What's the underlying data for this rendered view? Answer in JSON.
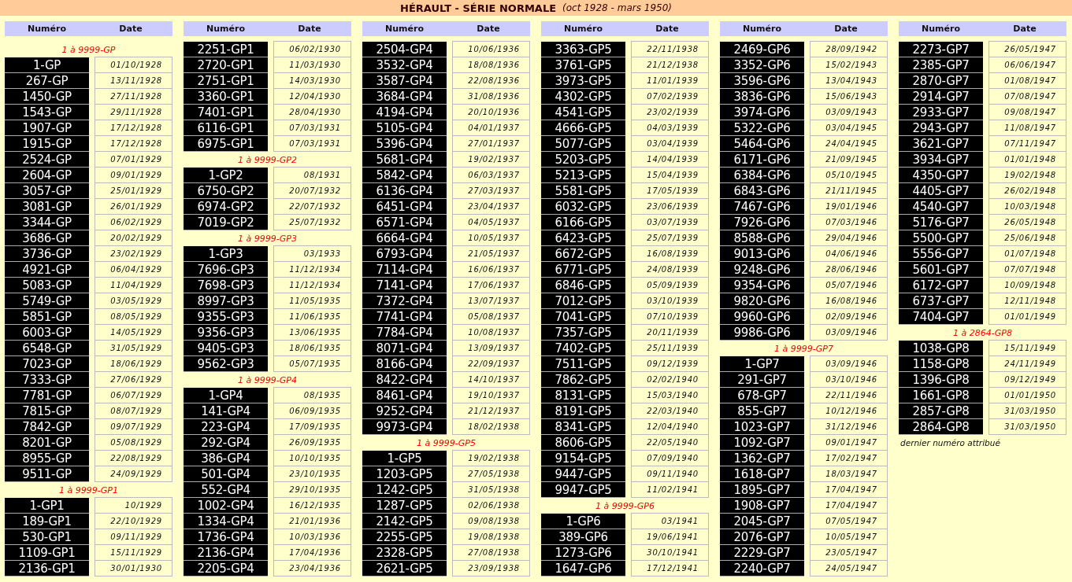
{
  "title": "HÉRAULT - SÉRIE NORMALE",
  "subtitle": "(oct 1928 - mars 1950)",
  "columns": [
    {
      "header": {
        "number": "Numéro",
        "date": "Date"
      },
      "items": [
        {
          "kind": "series",
          "label": "1 à 9999-GP"
        },
        {
          "kind": "plate",
          "number": "1-GP",
          "date": "01/10/1928"
        },
        {
          "kind": "plate",
          "number": "267-GP",
          "date": "13/11/1928"
        },
        {
          "kind": "plate",
          "number": "1450-GP",
          "date": "27/11/1928"
        },
        {
          "kind": "plate",
          "number": "1543-GP",
          "date": "29/11/1928"
        },
        {
          "kind": "plate",
          "number": "1907-GP",
          "date": "17/12/1928"
        },
        {
          "kind": "plate",
          "number": "1915-GP",
          "date": "17/12/1928"
        },
        {
          "kind": "plate",
          "number": "2524-GP",
          "date": "07/01/1929"
        },
        {
          "kind": "plate",
          "number": "2604-GP",
          "date": "09/01/1929"
        },
        {
          "kind": "plate",
          "number": "3057-GP",
          "date": "25/01/1929"
        },
        {
          "kind": "plate",
          "number": "3081-GP",
          "date": "26/01/1929"
        },
        {
          "kind": "plate",
          "number": "3344-GP",
          "date": "06/02/1929"
        },
        {
          "kind": "plate",
          "number": "3686-GP",
          "date": "20/02/1929"
        },
        {
          "kind": "plate",
          "number": "3736-GP",
          "date": "23/02/1929"
        },
        {
          "kind": "plate",
          "number": "4921-GP",
          "date": "06/04/1929"
        },
        {
          "kind": "plate",
          "number": "5083-GP",
          "date": "11/04/1929"
        },
        {
          "kind": "plate",
          "number": "5749-GP",
          "date": "03/05/1929"
        },
        {
          "kind": "plate",
          "number": "5851-GP",
          "date": "08/05/1929"
        },
        {
          "kind": "plate",
          "number": "6003-GP",
          "date": "14/05/1929"
        },
        {
          "kind": "plate",
          "number": "6548-GP",
          "date": "31/05/1929"
        },
        {
          "kind": "plate",
          "number": "7023-GP",
          "date": "18/06/1929"
        },
        {
          "kind": "plate",
          "number": "7333-GP",
          "date": "27/06/1929"
        },
        {
          "kind": "plate",
          "number": "7781-GP",
          "date": "06/07/1929"
        },
        {
          "kind": "plate",
          "number": "7815-GP",
          "date": "08/07/1929"
        },
        {
          "kind": "plate",
          "number": "7842-GP",
          "date": "09/07/1929"
        },
        {
          "kind": "plate",
          "number": "8201-GP",
          "date": "05/08/1929"
        },
        {
          "kind": "plate",
          "number": "8955-GP",
          "date": "22/08/1929"
        },
        {
          "kind": "plate",
          "number": "9511-GP",
          "date": "24/09/1929"
        },
        {
          "kind": "series",
          "label": "1 à 9999-GP1"
        },
        {
          "kind": "plate",
          "number": "1-GP1",
          "date": "10/1929"
        },
        {
          "kind": "plate",
          "number": "189-GP1",
          "date": "22/10/1929"
        },
        {
          "kind": "plate",
          "number": "530-GP1",
          "date": "09/11/1929"
        },
        {
          "kind": "plate",
          "number": "1109-GP1",
          "date": "15/11/1929"
        },
        {
          "kind": "plate",
          "number": "2136-GP1",
          "date": "30/01/1930"
        }
      ]
    },
    {
      "header": {
        "number": "Numéro",
        "date": "Date"
      },
      "items": [
        {
          "kind": "plate",
          "number": "2251-GP1",
          "date": "06/02/1930"
        },
        {
          "kind": "plate",
          "number": "2720-GP1",
          "date": "11/03/1930"
        },
        {
          "kind": "plate",
          "number": "2751-GP1",
          "date": "14/03/1930"
        },
        {
          "kind": "plate",
          "number": "3360-GP1",
          "date": "12/04/1930"
        },
        {
          "kind": "plate",
          "number": "7401-GP1",
          "date": "28/04/1930"
        },
        {
          "kind": "plate",
          "number": "6116-GP1",
          "date": "07/03/1931"
        },
        {
          "kind": "plate",
          "number": "6975-GP1",
          "date": "07/03/1931"
        },
        {
          "kind": "series",
          "label": "1 à 9999-GP2"
        },
        {
          "kind": "plate",
          "number": "1-GP2",
          "date": "08/1931"
        },
        {
          "kind": "plate",
          "number": "6750-GP2",
          "date": "20/07/1932"
        },
        {
          "kind": "plate",
          "number": "6974-GP2",
          "date": "22/07/1932"
        },
        {
          "kind": "plate",
          "number": "7019-GP2",
          "date": "25/07/1932"
        },
        {
          "kind": "series",
          "label": "1 à 9999-GP3"
        },
        {
          "kind": "plate",
          "number": "1-GP3",
          "date": "03/1933"
        },
        {
          "kind": "plate",
          "number": "7696-GP3",
          "date": "11/12/1934"
        },
        {
          "kind": "plate",
          "number": "7698-GP3",
          "date": "11/12/1934"
        },
        {
          "kind": "plate",
          "number": "8997-GP3",
          "date": "11/05/1935"
        },
        {
          "kind": "plate",
          "number": "9355-GP3",
          "date": "11/06/1935"
        },
        {
          "kind": "plate",
          "number": "9356-GP3",
          "date": "13/06/1935"
        },
        {
          "kind": "plate",
          "number": "9405-GP3",
          "date": "18/06/1935"
        },
        {
          "kind": "plate",
          "number": "9562-GP3",
          "date": "05/07/1935"
        },
        {
          "kind": "series",
          "label": "1 à 9999-GP4"
        },
        {
          "kind": "plate",
          "number": "1-GP4",
          "date": "08/1935"
        },
        {
          "kind": "plate",
          "number": "141-GP4",
          "date": "06/09/1935"
        },
        {
          "kind": "plate",
          "number": "223-GP4",
          "date": "17/09/1935"
        },
        {
          "kind": "plate",
          "number": "292-GP4",
          "date": "26/09/1935"
        },
        {
          "kind": "plate",
          "number": "386-GP4",
          "date": "10/10/1935"
        },
        {
          "kind": "plate",
          "number": "501-GP4",
          "date": "23/10/1935"
        },
        {
          "kind": "plate",
          "number": "552-GP4",
          "date": "29/10/1935"
        },
        {
          "kind": "plate",
          "number": "1002-GP4",
          "date": "16/12/1935"
        },
        {
          "kind": "plate",
          "number": "1334-GP4",
          "date": "21/01/1936"
        },
        {
          "kind": "plate",
          "number": "1736-GP4",
          "date": "10/03/1936"
        },
        {
          "kind": "plate",
          "number": "2136-GP4",
          "date": "17/04/1936"
        },
        {
          "kind": "plate",
          "number": "2205-GP4",
          "date": "23/04/1936"
        }
      ]
    },
    {
      "header": {
        "number": "Numéro",
        "date": "Date"
      },
      "items": [
        {
          "kind": "plate",
          "number": "2504-GP4",
          "date": "10/06/1936"
        },
        {
          "kind": "plate",
          "number": "3532-GP4",
          "date": "18/08/1936"
        },
        {
          "kind": "plate",
          "number": "3587-GP4",
          "date": "22/08/1936"
        },
        {
          "kind": "plate",
          "number": "3684-GP4",
          "date": "31/08/1936"
        },
        {
          "kind": "plate",
          "number": "4194-GP4",
          "date": "20/10/1936"
        },
        {
          "kind": "plate",
          "number": "5105-GP4",
          "date": "04/01/1937"
        },
        {
          "kind": "plate",
          "number": "5396-GP4",
          "date": "27/01/1937"
        },
        {
          "kind": "plate",
          "number": "5681-GP4",
          "date": "19/02/1937"
        },
        {
          "kind": "plate",
          "number": "5842-GP4",
          "date": "06/03/1937"
        },
        {
          "kind": "plate",
          "number": "6136-GP4",
          "date": "27/03/1937"
        },
        {
          "kind": "plate",
          "number": "6451-GP4",
          "date": "23/04/1937"
        },
        {
          "kind": "plate",
          "number": "6571-GP4",
          "date": "04/05/1937"
        },
        {
          "kind": "plate",
          "number": "6664-GP4",
          "date": "10/05/1937"
        },
        {
          "kind": "plate",
          "number": "6793-GP4",
          "date": "21/05/1937"
        },
        {
          "kind": "plate",
          "number": "7114-GP4",
          "date": "16/06/1937"
        },
        {
          "kind": "plate",
          "number": "7141-GP4",
          "date": "17/06/1937"
        },
        {
          "kind": "plate",
          "number": "7372-GP4",
          "date": "13/07/1937"
        },
        {
          "kind": "plate",
          "number": "7741-GP4",
          "date": "05/08/1937"
        },
        {
          "kind": "plate",
          "number": "7784-GP4",
          "date": "10/08/1937"
        },
        {
          "kind": "plate",
          "number": "8071-GP4",
          "date": "13/09/1937"
        },
        {
          "kind": "plate",
          "number": "8166-GP4",
          "date": "22/09/1937"
        },
        {
          "kind": "plate",
          "number": "8422-GP4",
          "date": "14/10/1937"
        },
        {
          "kind": "plate",
          "number": "8461-GP4",
          "date": "19/10/1937"
        },
        {
          "kind": "plate",
          "number": "9252-GP4",
          "date": "21/12/1937"
        },
        {
          "kind": "plate",
          "number": "9973-GP4",
          "date": "18/02/1938"
        },
        {
          "kind": "series",
          "label": "1 à 9999-GP5"
        },
        {
          "kind": "plate",
          "number": "1-GP5",
          "date": "19/02/1938"
        },
        {
          "kind": "plate",
          "number": "1203-GP5",
          "date": "27/05/1938"
        },
        {
          "kind": "plate",
          "number": "1242-GP5",
          "date": "31/05/1938"
        },
        {
          "kind": "plate",
          "number": "1287-GP5",
          "date": "02/06/1938"
        },
        {
          "kind": "plate",
          "number": "2142-GP5",
          "date": "09/08/1938"
        },
        {
          "kind": "plate",
          "number": "2255-GP5",
          "date": "19/08/1938"
        },
        {
          "kind": "plate",
          "number": "2328-GP5",
          "date": "27/08/1938"
        },
        {
          "kind": "plate",
          "number": "2621-GP5",
          "date": "23/09/1938"
        }
      ]
    },
    {
      "header": {
        "number": "Numéro",
        "date": "Date"
      },
      "items": [
        {
          "kind": "plate",
          "number": "3363-GP5",
          "date": "22/11/1938"
        },
        {
          "kind": "plate",
          "number": "3761-GP5",
          "date": "21/12/1938"
        },
        {
          "kind": "plate",
          "number": "3973-GP5",
          "date": "11/01/1939"
        },
        {
          "kind": "plate",
          "number": "4302-GP5",
          "date": "07/02/1939"
        },
        {
          "kind": "plate",
          "number": "4541-GP5",
          "date": "23/02/1939"
        },
        {
          "kind": "plate",
          "number": "4666-GP5",
          "date": "04/03/1939"
        },
        {
          "kind": "plate",
          "number": "5077-GP5",
          "date": "03/04/1939"
        },
        {
          "kind": "plate",
          "number": "5203-GP5",
          "date": "14/04/1939"
        },
        {
          "kind": "plate",
          "number": "5213-GP5",
          "date": "15/04/1939"
        },
        {
          "kind": "plate",
          "number": "5581-GP5",
          "date": "17/05/1939"
        },
        {
          "kind": "plate",
          "number": "6032-GP5",
          "date": "23/06/1939"
        },
        {
          "kind": "plate",
          "number": "6166-GP5",
          "date": "03/07/1939"
        },
        {
          "kind": "plate",
          "number": "6423-GP5",
          "date": "25/07/1939"
        },
        {
          "kind": "plate",
          "number": "6672-GP5",
          "date": "16/08/1939"
        },
        {
          "kind": "plate",
          "number": "6771-GP5",
          "date": "24/08/1939"
        },
        {
          "kind": "plate",
          "number": "6846-GP5",
          "date": "05/09/1939"
        },
        {
          "kind": "plate",
          "number": "7012-GP5",
          "date": "03/10/1939"
        },
        {
          "kind": "plate",
          "number": "7041-GP5",
          "date": "07/10/1939"
        },
        {
          "kind": "plate",
          "number": "7357-GP5",
          "date": "20/11/1939"
        },
        {
          "kind": "plate",
          "number": "7402-GP5",
          "date": "25/11/1939"
        },
        {
          "kind": "plate",
          "number": "7511-GP5",
          "date": "09/12/1939"
        },
        {
          "kind": "plate",
          "number": "7862-GP5",
          "date": "02/02/1940"
        },
        {
          "kind": "plate",
          "number": "8131-GP5",
          "date": "15/03/1940"
        },
        {
          "kind": "plate",
          "number": "8191-GP5",
          "date": "22/03/1940"
        },
        {
          "kind": "plate",
          "number": "8341-GP5",
          "date": "12/04/1940"
        },
        {
          "kind": "plate",
          "number": "8606-GP5",
          "date": "22/05/1940"
        },
        {
          "kind": "plate",
          "number": "9154-GP5",
          "date": "07/09/1940"
        },
        {
          "kind": "plate",
          "number": "9447-GP5",
          "date": "09/11/1940"
        },
        {
          "kind": "plate",
          "number": "9947-GP5",
          "date": "11/02/1941"
        },
        {
          "kind": "series",
          "label": "1 à 9999-GP6"
        },
        {
          "kind": "plate",
          "number": "1-GP6",
          "date": "03/1941"
        },
        {
          "kind": "plate",
          "number": "389-GP6",
          "date": "19/06/1941"
        },
        {
          "kind": "plate",
          "number": "1273-GP6",
          "date": "30/10/1941"
        },
        {
          "kind": "plate",
          "number": "1647-GP6",
          "date": "17/12/1941"
        }
      ]
    },
    {
      "header": {
        "number": "Numéro",
        "date": "Date"
      },
      "items": [
        {
          "kind": "plate",
          "number": "2469-GP6",
          "date": "28/09/1942"
        },
        {
          "kind": "plate",
          "number": "3352-GP6",
          "date": "15/02/1943"
        },
        {
          "kind": "plate",
          "number": "3596-GP6",
          "date": "13/04/1943"
        },
        {
          "kind": "plate",
          "number": "3836-GP6",
          "date": "15/06/1943"
        },
        {
          "kind": "plate",
          "number": "3974-GP6",
          "date": "03/09/1943"
        },
        {
          "kind": "plate",
          "number": "5322-GP6",
          "date": "03/04/1945"
        },
        {
          "kind": "plate",
          "number": "5464-GP6",
          "date": "24/04/1945"
        },
        {
          "kind": "plate",
          "number": "6171-GP6",
          "date": "21/09/1945"
        },
        {
          "kind": "plate",
          "number": "6384-GP6",
          "date": "05/10/1945"
        },
        {
          "kind": "plate",
          "number": "6843-GP6",
          "date": "21/11/1945"
        },
        {
          "kind": "plate",
          "number": "7467-GP6",
          "date": "19/01/1946"
        },
        {
          "kind": "plate",
          "number": "7926-GP6",
          "date": "07/03/1946"
        },
        {
          "kind": "plate",
          "number": "8588-GP6",
          "date": "29/04/1946"
        },
        {
          "kind": "plate",
          "number": "9013-GP6",
          "date": "04/06/1946"
        },
        {
          "kind": "plate",
          "number": "9248-GP6",
          "date": "28/06/1946"
        },
        {
          "kind": "plate",
          "number": "9354-GP6",
          "date": "05/07/1946"
        },
        {
          "kind": "plate",
          "number": "9820-GP6",
          "date": "16/08/1946"
        },
        {
          "kind": "plate",
          "number": "9960-GP6",
          "date": "02/09/1946"
        },
        {
          "kind": "plate",
          "number": "9986-GP6",
          "date": "03/09/1946"
        },
        {
          "kind": "series",
          "label": "1 à 9999-GP7"
        },
        {
          "kind": "plate",
          "number": "1-GP7",
          "date": "03/09/1946"
        },
        {
          "kind": "plate",
          "number": "291-GP7",
          "date": "03/10/1946"
        },
        {
          "kind": "plate",
          "number": "678-GP7",
          "date": "22/11/1946"
        },
        {
          "kind": "plate",
          "number": "855-GP7",
          "date": "10/12/1946"
        },
        {
          "kind": "plate",
          "number": "1023-GP7",
          "date": "31/12/1946"
        },
        {
          "kind": "plate",
          "number": "1092-GP7",
          "date": "09/01/1947"
        },
        {
          "kind": "plate",
          "number": "1362-GP7",
          "date": "17/02/1947"
        },
        {
          "kind": "plate",
          "number": "1618-GP7",
          "date": "18/03/1947"
        },
        {
          "kind": "plate",
          "number": "1895-GP7",
          "date": "17/04/1947"
        },
        {
          "kind": "plate",
          "number": "1908-GP7",
          "date": "17/04/1947"
        },
        {
          "kind": "plate",
          "number": "2045-GP7",
          "date": "07/05/1947"
        },
        {
          "kind": "plate",
          "number": "2076-GP7",
          "date": "10/05/1947"
        },
        {
          "kind": "plate",
          "number": "2229-GP7",
          "date": "23/05/1947"
        },
        {
          "kind": "plate",
          "number": "2240-GP7",
          "date": "24/05/1947"
        }
      ]
    },
    {
      "header": {
        "number": "Numéro",
        "date": "Date"
      },
      "items": [
        {
          "kind": "plate",
          "number": "2273-GP7",
          "date": "26/05/1947"
        },
        {
          "kind": "plate",
          "number": "2385-GP7",
          "date": "06/06/1947"
        },
        {
          "kind": "plate",
          "number": "2870-GP7",
          "date": "01/08/1947"
        },
        {
          "kind": "plate",
          "number": "2914-GP7",
          "date": "07/08/1947"
        },
        {
          "kind": "plate",
          "number": "2933-GP7",
          "date": "09/08/1947"
        },
        {
          "kind": "plate",
          "number": "2943-GP7",
          "date": "11/08/1947"
        },
        {
          "kind": "plate",
          "number": "3621-GP7",
          "date": "07/11/1947"
        },
        {
          "kind": "plate",
          "number": "3934-GP7",
          "date": "01/01/1948"
        },
        {
          "kind": "plate",
          "number": "4350-GP7",
          "date": "19/02/1948"
        },
        {
          "kind": "plate",
          "number": "4405-GP7",
          "date": "26/02/1948"
        },
        {
          "kind": "plate",
          "number": "4540-GP7",
          "date": "10/03/1948"
        },
        {
          "kind": "plate",
          "number": "5176-GP7",
          "date": "26/05/1948"
        },
        {
          "kind": "plate",
          "number": "5500-GP7",
          "date": "25/06/1948"
        },
        {
          "kind": "plate",
          "number": "5556-GP7",
          "date": "01/07/1948"
        },
        {
          "kind": "plate",
          "number": "5601-GP7",
          "date": "07/07/1948"
        },
        {
          "kind": "plate",
          "number": "6172-GP7",
          "date": "10/09/1948"
        },
        {
          "kind": "plate",
          "number": "6737-GP7",
          "date": "12/11/1948"
        },
        {
          "kind": "plate",
          "number": "7404-GP7",
          "date": "01/01/1949"
        },
        {
          "kind": "series",
          "label": "1 à 2864-GP8"
        },
        {
          "kind": "plate",
          "number": "1038-GP8",
          "date": "15/11/1949"
        },
        {
          "kind": "plate",
          "number": "1158-GP8",
          "date": "24/11/1949"
        },
        {
          "kind": "plate",
          "number": "1396-GP8",
          "date": "09/12/1949"
        },
        {
          "kind": "plate",
          "number": "1661-GP8",
          "date": "01/01/1950"
        },
        {
          "kind": "plate",
          "number": "2857-GP8",
          "date": "31/03/1950"
        },
        {
          "kind": "plate",
          "number": "2864-GP8",
          "date": "31/03/1950"
        },
        {
          "kind": "note",
          "text": "dernier numéro attribué"
        }
      ]
    }
  ]
}
